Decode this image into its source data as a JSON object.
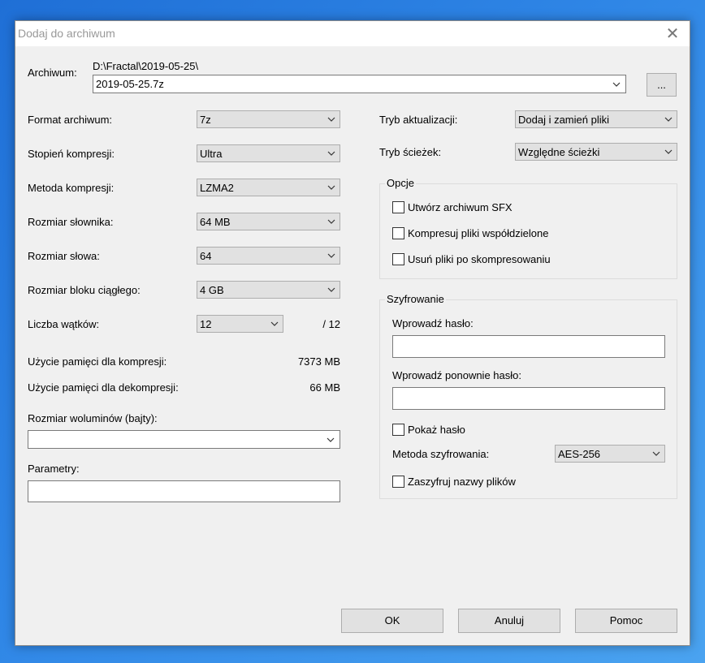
{
  "window": {
    "title": "Dodaj do archiwum",
    "close_glyph": "✕"
  },
  "archive": {
    "label": "Archiwum:",
    "path": "D:\\Fractal\\2019-05-25\\",
    "name": "2019-05-25.7z",
    "browse_label": "..."
  },
  "left": {
    "format": {
      "label": "Format archiwum:",
      "value": "7z"
    },
    "level": {
      "label": "Stopień kompresji:",
      "value": "Ultra"
    },
    "method": {
      "label": "Metoda kompresji:",
      "value": "LZMA2"
    },
    "dict": {
      "label": "Rozmiar słownika:",
      "value": "64 MB"
    },
    "word": {
      "label": "Rozmiar słowa:",
      "value": "64"
    },
    "solid": {
      "label": "Rozmiar bloku ciągłego:",
      "value": "4 GB"
    },
    "threads": {
      "label": "Liczba wątków:",
      "value": "12",
      "max": "/ 12"
    },
    "mem_comp": {
      "label": "Użycie pamięci dla kompresji:",
      "value": "7373 MB"
    },
    "mem_decomp": {
      "label": "Użycie pamięci dla dekompresji:",
      "value": "66 MB"
    },
    "volumes": {
      "label": "Rozmiar woluminów (bajty):",
      "value": ""
    },
    "params": {
      "label": "Parametry:",
      "value": ""
    }
  },
  "right": {
    "update_mode": {
      "label": "Tryb aktualizacji:",
      "value": "Dodaj i zamień pliki"
    },
    "path_mode": {
      "label": "Tryb ścieżek:",
      "value": "Względne ścieżki"
    },
    "options": {
      "title": "Opcje",
      "sfx": "Utwórz archiwum SFX",
      "shared": "Kompresuj pliki współdzielone",
      "delete": "Usuń pliki po skompresowaniu"
    },
    "encryption": {
      "title": "Szyfrowanie",
      "password_label": "Wprowadź hasło:",
      "password_value": "",
      "repeat_label": "Wprowadź ponownie hasło:",
      "repeat_value": "",
      "show_password": "Pokaż hasło",
      "method_label": "Metoda szyfrowania:",
      "method_value": "AES-256",
      "encrypt_names": "Zaszyfruj nazwy plików"
    }
  },
  "buttons": {
    "ok": "OK",
    "cancel": "Anuluj",
    "help": "Pomoc"
  },
  "colors": {
    "desktop": "#2f86e6",
    "dialog_bg": "#f0f0f0",
    "button_bg": "#e1e1e1"
  }
}
